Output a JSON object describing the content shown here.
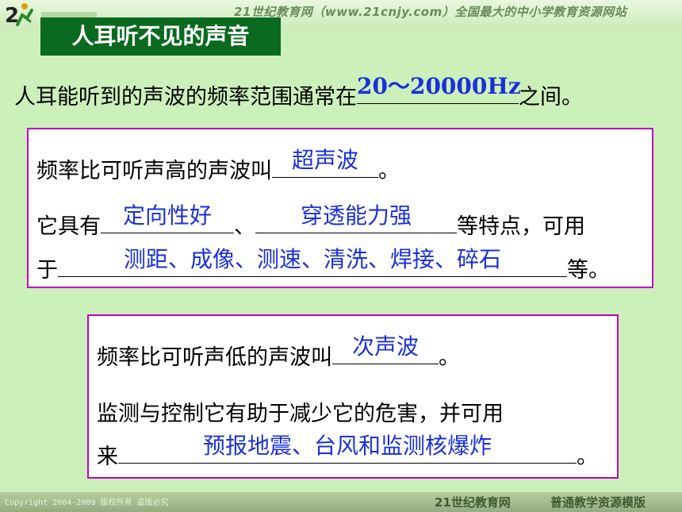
{
  "header": {
    "site_text": "21世纪教育网（www.21cnjy.com）全国最大的中小学教育资源网站",
    "logo": "runner-logo-icon"
  },
  "title": "人耳听不见的声音",
  "intro": {
    "before": "人耳能听到的声波的频率范围通常在",
    "answer": "20～20000Hz",
    "after": "之间。"
  },
  "ultrasound": {
    "line1_before": "频率比可听声高的声波叫",
    "line1_answer": "超声波",
    "line1_after": "。",
    "line2_before": "它具有",
    "line2_answer1": "定向性好",
    "line2_sep": "、",
    "line2_answer2": "穿透能力强",
    "line2_after": "等特点，可用",
    "line3_before": "于",
    "line3_answer": "测距、成像、测速、清洗、焊接、碎石",
    "line3_after": "等。"
  },
  "infrasound": {
    "line1_before": "频率比可听声低的声波叫",
    "line1_answer": "次声波",
    "line1_after": "。",
    "line2": "监测与控制它有助于减少它的危害，并可用",
    "line3_before": "来",
    "line3_answer": "预报地震、台风和监测核爆炸",
    "line3_after": "。"
  },
  "footer": {
    "copyright": "Copyright 2004-2009 版权所有 盗版必究",
    "brand": "21世纪教育网",
    "template": "普通教学资源模版"
  },
  "colors": {
    "background": "#ccf0ba",
    "title_bg": "#0a6a20",
    "answer": "#1a30d8",
    "box_border": "#c000c0"
  }
}
